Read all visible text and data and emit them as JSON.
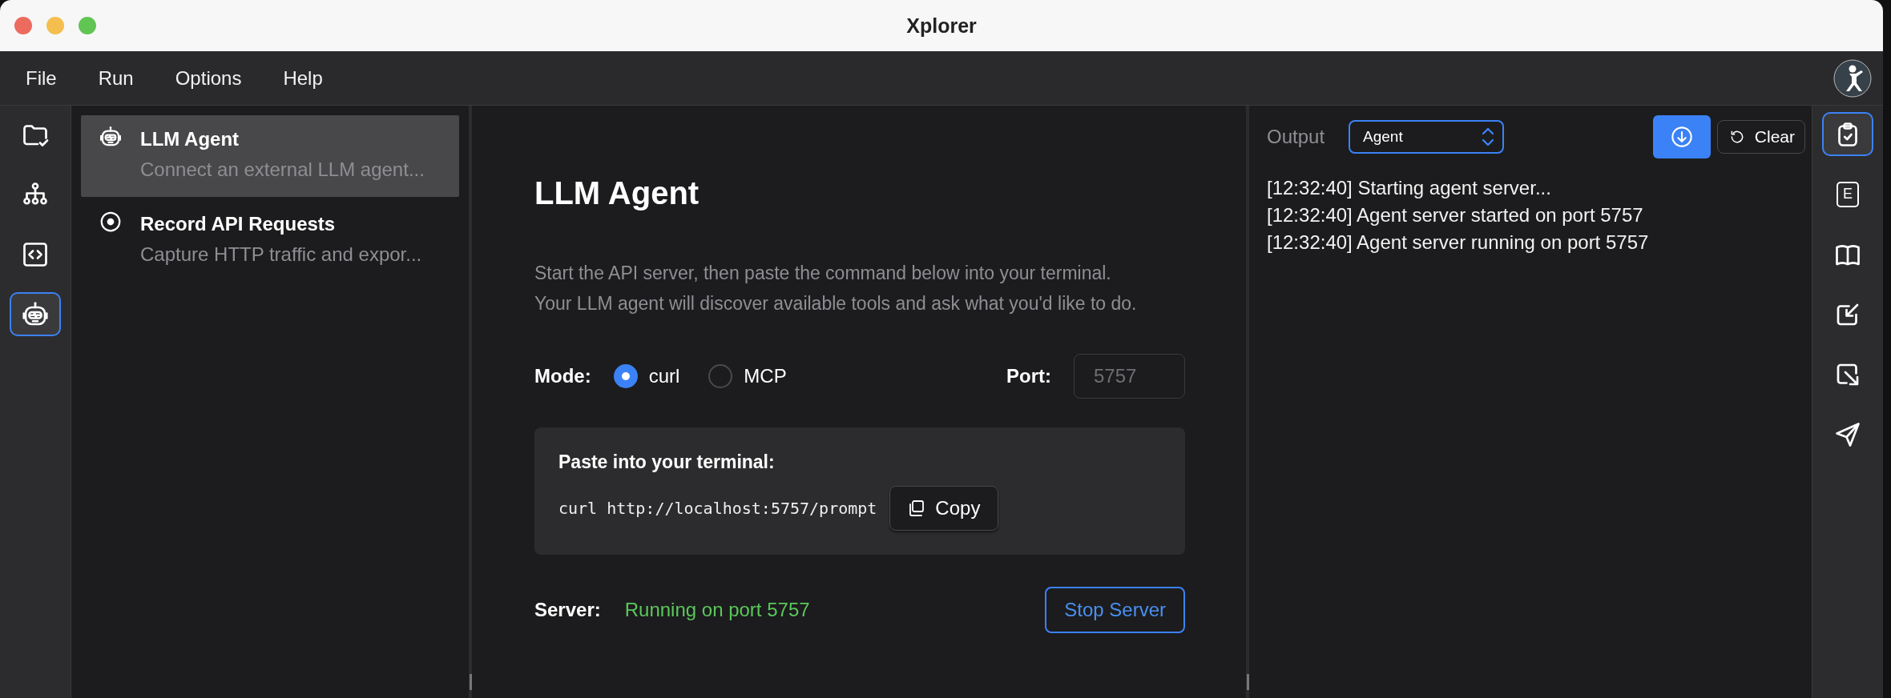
{
  "window": {
    "title": "Xplorer"
  },
  "menu": [
    {
      "label": "File"
    },
    {
      "label": "Run"
    },
    {
      "label": "Options"
    },
    {
      "label": "Help"
    }
  ],
  "left_rail": [
    {
      "kind": "folder",
      "selected": false
    },
    {
      "kind": "network",
      "selected": false
    },
    {
      "kind": "code",
      "selected": false
    },
    {
      "kind": "robot",
      "selected": true
    }
  ],
  "features": [
    {
      "kind": "robot",
      "title": "LLM Agent",
      "subtitle": "Connect an external LLM agent...",
      "selected": true
    },
    {
      "kind": "record",
      "title": "Record API Requests",
      "subtitle": "Capture HTTP traffic and expor...",
      "selected": false
    }
  ],
  "panel": {
    "title": "LLM Agent",
    "description": [
      "Start the API server, then paste the command below into your terminal.",
      "Your LLM agent will discover available tools and ask what you'd like to do."
    ],
    "mode_label": "Mode:",
    "modes": [
      {
        "label": "curl",
        "selected": true
      },
      {
        "label": "MCP",
        "selected": false
      }
    ],
    "port_label": "Port:",
    "port_field": {
      "placeholder": "5757"
    },
    "command_box": {
      "heading": "Paste into your terminal:",
      "command": "curl http://localhost:5757/prompt",
      "copy_button": "Copy"
    },
    "server_label": "Server:",
    "server_status": "Running on port 5757",
    "stop_button": "Stop Server"
  },
  "output": {
    "label": "Output",
    "source": "Agent",
    "clear_button": "Clear",
    "log": [
      "[12:32:40] Starting agent server...",
      "[12:32:40] Agent server started on port 5757",
      "[12:32:40] Agent server running on port 5757"
    ]
  },
  "right_rail": [
    {
      "kind": "clipboard",
      "selected": true
    },
    {
      "kind": "letter",
      "label": "E",
      "selected": false
    },
    {
      "kind": "book",
      "selected": false
    },
    {
      "kind": "import",
      "selected": false
    },
    {
      "kind": "export",
      "selected": false
    },
    {
      "kind": "send",
      "selected": false
    }
  ]
}
